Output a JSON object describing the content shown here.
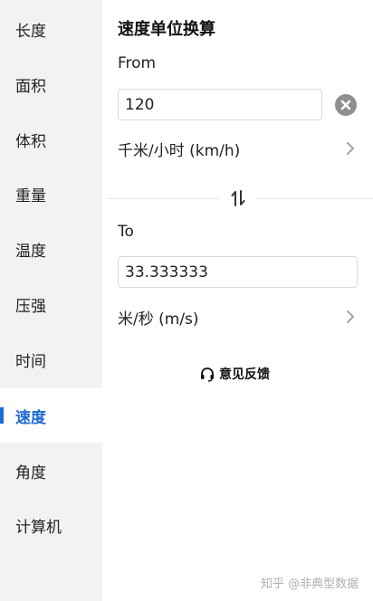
{
  "sidebar": {
    "items": [
      {
        "label": "长度",
        "active": false
      },
      {
        "label": "面积",
        "active": false
      },
      {
        "label": "体积",
        "active": false
      },
      {
        "label": "重量",
        "active": false
      },
      {
        "label": "温度",
        "active": false
      },
      {
        "label": "压强",
        "active": false
      },
      {
        "label": "时间",
        "active": false
      },
      {
        "label": "速度",
        "active": true
      },
      {
        "label": "角度",
        "active": false
      },
      {
        "label": "计算机",
        "active": false
      }
    ]
  },
  "main": {
    "title": "速度单位换算",
    "from": {
      "label": "From",
      "value": "120",
      "unit": "千米/小时 (km/h)"
    },
    "to": {
      "label": "To",
      "value": "33.333333",
      "unit": "米/秒 (m/s)"
    },
    "feedback_label": "意见反馈"
  },
  "watermark": "知乎 @非典型数据",
  "colors": {
    "accent": "#1e6bd6",
    "sidebar_bg": "#f2f2f2",
    "clear_button": "#8e8e8e"
  },
  "icons": {
    "clear": "close-circle-icon",
    "unit_chevron": "chevron-right-icon",
    "swap": "swap-vertical-icon",
    "feedback": "headset-icon"
  }
}
